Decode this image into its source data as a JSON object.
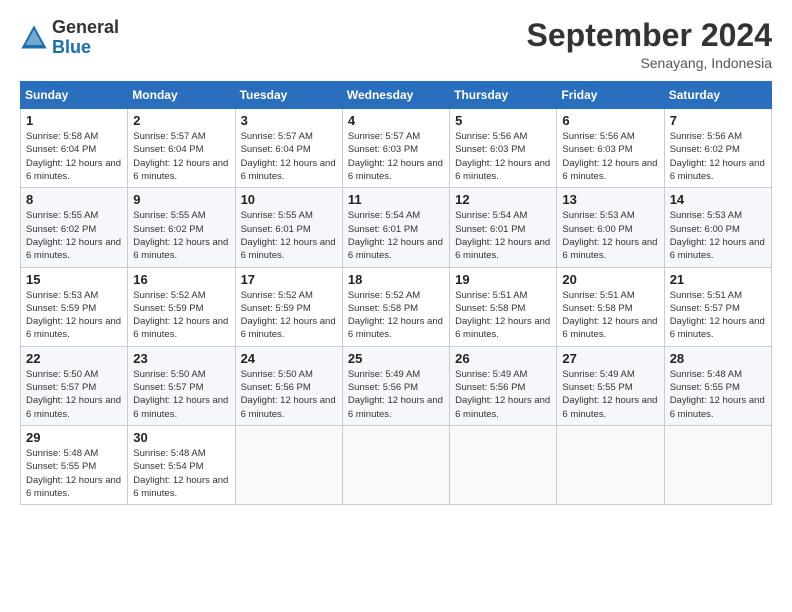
{
  "logo": {
    "general": "General",
    "blue": "Blue"
  },
  "title": "September 2024",
  "location": "Senayang, Indonesia",
  "days_of_week": [
    "Sunday",
    "Monday",
    "Tuesday",
    "Wednesday",
    "Thursday",
    "Friday",
    "Saturday"
  ],
  "weeks": [
    [
      {
        "day": "1",
        "sunrise": "5:58 AM",
        "sunset": "6:04 PM",
        "daylight": "12 hours and 6 minutes."
      },
      {
        "day": "2",
        "sunrise": "5:57 AM",
        "sunset": "6:04 PM",
        "daylight": "12 hours and 6 minutes."
      },
      {
        "day": "3",
        "sunrise": "5:57 AM",
        "sunset": "6:04 PM",
        "daylight": "12 hours and 6 minutes."
      },
      {
        "day": "4",
        "sunrise": "5:57 AM",
        "sunset": "6:03 PM",
        "daylight": "12 hours and 6 minutes."
      },
      {
        "day": "5",
        "sunrise": "5:56 AM",
        "sunset": "6:03 PM",
        "daylight": "12 hours and 6 minutes."
      },
      {
        "day": "6",
        "sunrise": "5:56 AM",
        "sunset": "6:03 PM",
        "daylight": "12 hours and 6 minutes."
      },
      {
        "day": "7",
        "sunrise": "5:56 AM",
        "sunset": "6:02 PM",
        "daylight": "12 hours and 6 minutes."
      }
    ],
    [
      {
        "day": "8",
        "sunrise": "5:55 AM",
        "sunset": "6:02 PM",
        "daylight": "12 hours and 6 minutes."
      },
      {
        "day": "9",
        "sunrise": "5:55 AM",
        "sunset": "6:02 PM",
        "daylight": "12 hours and 6 minutes."
      },
      {
        "day": "10",
        "sunrise": "5:55 AM",
        "sunset": "6:01 PM",
        "daylight": "12 hours and 6 minutes."
      },
      {
        "day": "11",
        "sunrise": "5:54 AM",
        "sunset": "6:01 PM",
        "daylight": "12 hours and 6 minutes."
      },
      {
        "day": "12",
        "sunrise": "5:54 AM",
        "sunset": "6:01 PM",
        "daylight": "12 hours and 6 minutes."
      },
      {
        "day": "13",
        "sunrise": "5:53 AM",
        "sunset": "6:00 PM",
        "daylight": "12 hours and 6 minutes."
      },
      {
        "day": "14",
        "sunrise": "5:53 AM",
        "sunset": "6:00 PM",
        "daylight": "12 hours and 6 minutes."
      }
    ],
    [
      {
        "day": "15",
        "sunrise": "5:53 AM",
        "sunset": "5:59 PM",
        "daylight": "12 hours and 6 minutes."
      },
      {
        "day": "16",
        "sunrise": "5:52 AM",
        "sunset": "5:59 PM",
        "daylight": "12 hours and 6 minutes."
      },
      {
        "day": "17",
        "sunrise": "5:52 AM",
        "sunset": "5:59 PM",
        "daylight": "12 hours and 6 minutes."
      },
      {
        "day": "18",
        "sunrise": "5:52 AM",
        "sunset": "5:58 PM",
        "daylight": "12 hours and 6 minutes."
      },
      {
        "day": "19",
        "sunrise": "5:51 AM",
        "sunset": "5:58 PM",
        "daylight": "12 hours and 6 minutes."
      },
      {
        "day": "20",
        "sunrise": "5:51 AM",
        "sunset": "5:58 PM",
        "daylight": "12 hours and 6 minutes."
      },
      {
        "day": "21",
        "sunrise": "5:51 AM",
        "sunset": "5:57 PM",
        "daylight": "12 hours and 6 minutes."
      }
    ],
    [
      {
        "day": "22",
        "sunrise": "5:50 AM",
        "sunset": "5:57 PM",
        "daylight": "12 hours and 6 minutes."
      },
      {
        "day": "23",
        "sunrise": "5:50 AM",
        "sunset": "5:57 PM",
        "daylight": "12 hours and 6 minutes."
      },
      {
        "day": "24",
        "sunrise": "5:50 AM",
        "sunset": "5:56 PM",
        "daylight": "12 hours and 6 minutes."
      },
      {
        "day": "25",
        "sunrise": "5:49 AM",
        "sunset": "5:56 PM",
        "daylight": "12 hours and 6 minutes."
      },
      {
        "day": "26",
        "sunrise": "5:49 AM",
        "sunset": "5:56 PM",
        "daylight": "12 hours and 6 minutes."
      },
      {
        "day": "27",
        "sunrise": "5:49 AM",
        "sunset": "5:55 PM",
        "daylight": "12 hours and 6 minutes."
      },
      {
        "day": "28",
        "sunrise": "5:48 AM",
        "sunset": "5:55 PM",
        "daylight": "12 hours and 6 minutes."
      }
    ],
    [
      {
        "day": "29",
        "sunrise": "5:48 AM",
        "sunset": "5:55 PM",
        "daylight": "12 hours and 6 minutes."
      },
      {
        "day": "30",
        "sunrise": "5:48 AM",
        "sunset": "5:54 PM",
        "daylight": "12 hours and 6 minutes."
      },
      null,
      null,
      null,
      null,
      null
    ]
  ]
}
